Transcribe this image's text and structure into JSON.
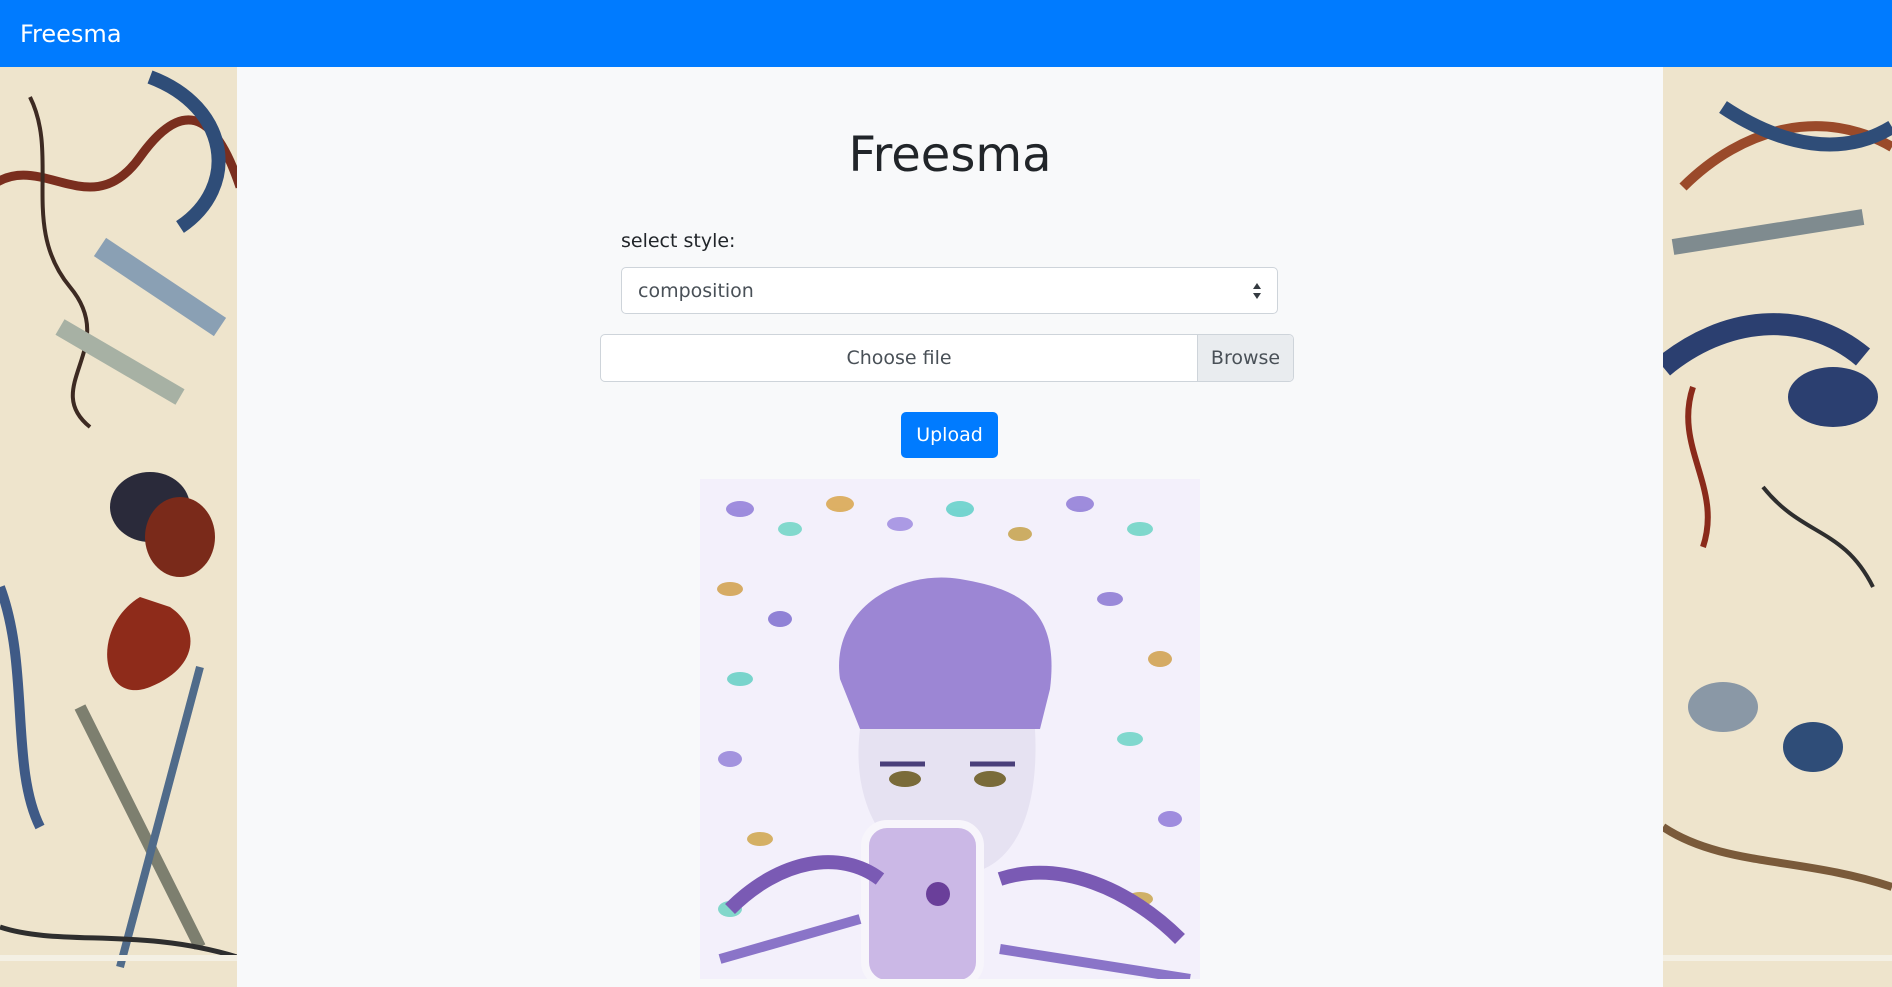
{
  "navbar": {
    "brand": "Freesma"
  },
  "main": {
    "title": "Freesma",
    "style_label": "select style:",
    "style_select": {
      "selected": "composition"
    },
    "file_input": {
      "placeholder": "Choose file",
      "browse_label": "Browse"
    },
    "upload_label": "Upload"
  },
  "colors": {
    "navbar": "#007bff",
    "page_bg": "#f8f9fa",
    "button": "#007bff"
  },
  "images": {
    "left_background": "abstract-watercolor-painting",
    "right_background": "abstract-watercolor-painting",
    "result": "stylized-portrait-selfie"
  }
}
